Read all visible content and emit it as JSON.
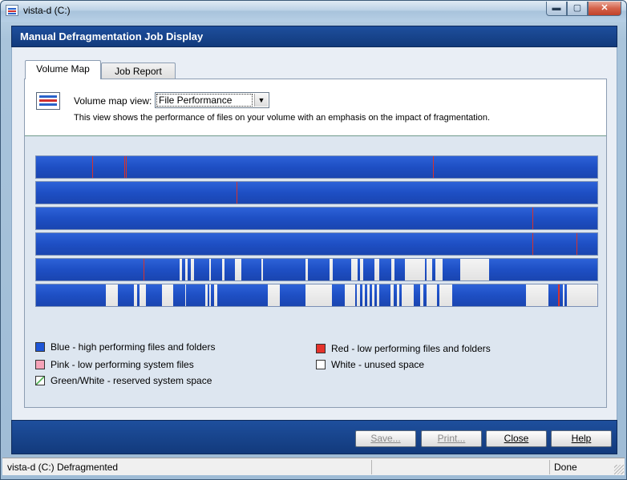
{
  "window": {
    "title": "vista-d (C:)",
    "minimize_label": "▬",
    "maximize_label": "▢",
    "close_label": "✕"
  },
  "header": {
    "title": "Manual Defragmentation Job Display"
  },
  "tabs": [
    {
      "label": "Volume Map",
      "active": true
    },
    {
      "label": "Job Report",
      "active": false
    }
  ],
  "volume_map": {
    "view_label": "Volume map view:",
    "selected_view": "File Performance",
    "description": "This view shows the performance of files on your volume with an emphasis on the impact of fragmentation."
  },
  "legend": [
    {
      "label": "Blue - high performing files and folders",
      "color": "#1d55d6"
    },
    {
      "label": "Red - low performing files and folders",
      "color": "#e5322b"
    },
    {
      "label": "Pink - low performing system files",
      "color": "#f5a3b8"
    },
    {
      "label": "White - unused space",
      "color": "#ffffff"
    },
    {
      "label": "Green/White - reserved system space",
      "color": "#4caf50"
    }
  ],
  "buttons": {
    "save": "Save...",
    "print": "Print...",
    "close": "Close",
    "help": "Help"
  },
  "status": {
    "left": "vista-d (C:) Defragmented",
    "right": "Done"
  }
}
